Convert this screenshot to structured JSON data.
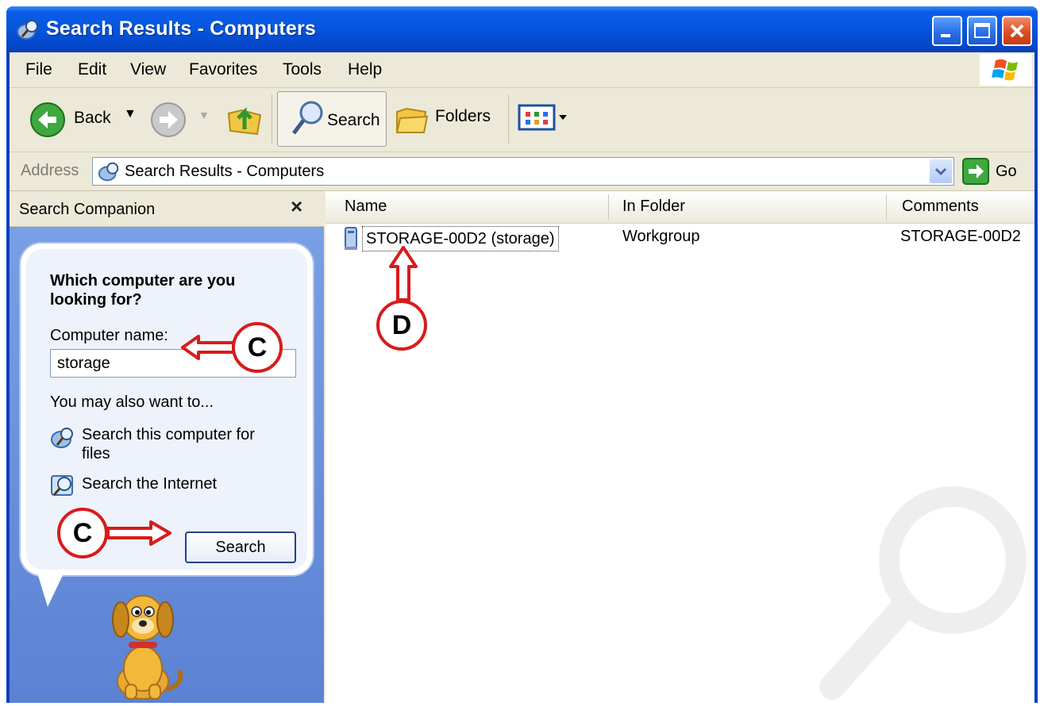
{
  "window": {
    "title": "Search Results - Computers"
  },
  "menu": [
    "File",
    "Edit",
    "View",
    "Favorites",
    "Tools",
    "Help"
  ],
  "toolbar": {
    "back_label": "Back",
    "search_label": "Search",
    "folders_label": "Folders"
  },
  "address": {
    "label": "Address",
    "value": "Search Results - Computers",
    "go_label": "Go"
  },
  "search_companion": {
    "title": "Search Companion",
    "close_glyph": "×",
    "question": "Which computer are you looking for?",
    "computer_name_label": "Computer name:",
    "computer_name_value": "storage",
    "also_label": "You may also want to...",
    "option_files": "Search this computer for files",
    "option_internet": "Search the Internet",
    "search_button": "Search"
  },
  "results": {
    "columns": [
      "Name",
      "In Folder",
      "Comments"
    ],
    "rows": [
      {
        "name": "STORAGE-00D2 (storage)",
        "in_folder": "Workgroup",
        "comments": "STORAGE-00D2"
      }
    ]
  },
  "annotations": {
    "callout_input": "C",
    "callout_button": "C",
    "callout_result": "D",
    "accent_color": "#d81b1b"
  },
  "icons": [
    "search-results-icon",
    "back-arrow-icon",
    "forward-arrow-icon",
    "up-folder-icon",
    "search-magnifier-icon",
    "folders-icon",
    "views-icon",
    "windows-flag-icon",
    "go-arrow-icon",
    "computer-icon",
    "globe-search-icon",
    "search-dog-icon"
  ]
}
